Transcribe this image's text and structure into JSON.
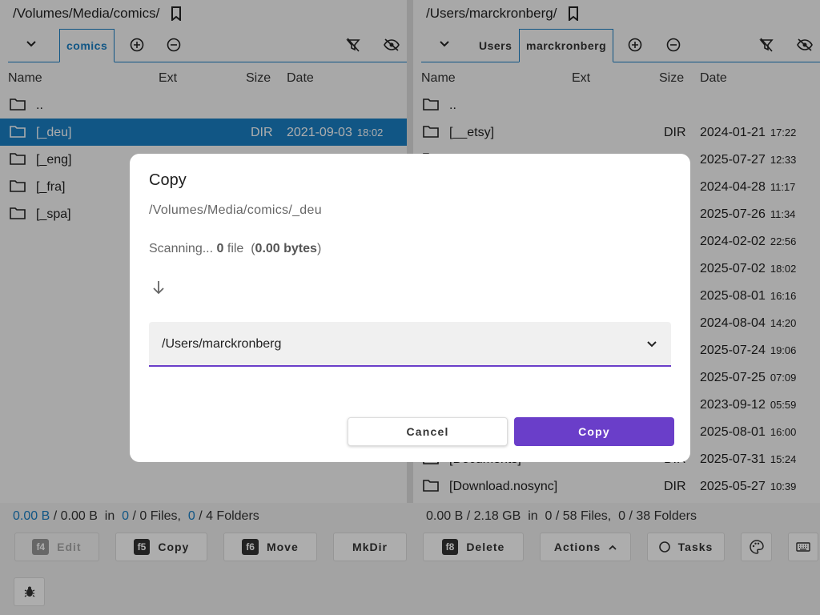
{
  "left": {
    "path": "/Volumes/Media/comics/",
    "tabs": [
      {
        "label": "comics",
        "active": true
      }
    ],
    "columns": {
      "name": "Name",
      "ext": "Ext",
      "size": "Size",
      "date": "Date"
    },
    "rows": [
      {
        "name": "..",
        "size": "",
        "date": "",
        "time": ""
      },
      {
        "name": "[_deu]",
        "size": "DIR",
        "date": "2021-09-03",
        "time": "18:02",
        "selected": true
      },
      {
        "name": "[_eng]",
        "size": "",
        "date": "",
        "time": ""
      },
      {
        "name": "[_fra]",
        "size": "",
        "date": "",
        "time": ""
      },
      {
        "name": "[_spa]",
        "size": "",
        "date": "",
        "time": ""
      }
    ],
    "status": {
      "sel_size": "0.00 B",
      "total_size": "/ 0.00 B",
      "in": "in",
      "sel_files": "0",
      "files": "/ 0 Files,",
      "sel_folders": "0",
      "folders": "/ 4 Folders"
    }
  },
  "right": {
    "path": "/Users/marckronberg/",
    "tabs": [
      {
        "label": "Users",
        "active": false
      },
      {
        "label": "marckronberg",
        "active": true
      }
    ],
    "columns": {
      "name": "Name",
      "ext": "Ext",
      "size": "Size",
      "date": "Date"
    },
    "rows": [
      {
        "name": "..",
        "size": "",
        "date": "",
        "time": ""
      },
      {
        "name": "[__etsy]",
        "size": "DIR",
        "date": "2024-01-21",
        "time": "17:22"
      },
      {
        "name": "",
        "size": "",
        "date": "2025-07-27",
        "time": "12:33"
      },
      {
        "name": "",
        "size": "",
        "date": "2024-04-28",
        "time": "11:17"
      },
      {
        "name": "",
        "size": "",
        "date": "2025-07-26",
        "time": "11:34"
      },
      {
        "name": "",
        "size": "",
        "date": "2024-02-02",
        "time": "22:56"
      },
      {
        "name": "",
        "size": "",
        "date": "2025-07-02",
        "time": "18:02"
      },
      {
        "name": "",
        "size": "",
        "date": "2025-08-01",
        "time": "16:16"
      },
      {
        "name": "",
        "size": "",
        "date": "2024-08-04",
        "time": "14:20"
      },
      {
        "name": "",
        "size": "",
        "date": "2025-07-24",
        "time": "19:06"
      },
      {
        "name": "",
        "size": "",
        "date": "2025-07-25",
        "time": "07:09"
      },
      {
        "name": "",
        "size": "",
        "date": "2023-09-12",
        "time": "05:59"
      },
      {
        "name": "",
        "size": "",
        "date": "2025-08-01",
        "time": "16:00"
      },
      {
        "name": "[Documents]",
        "size": "DIR",
        "date": "2025-07-31",
        "time": "15:24"
      },
      {
        "name": "[Download.nosync]",
        "size": "DIR",
        "date": "2025-05-27",
        "time": "10:39"
      }
    ],
    "status": {
      "text": "0.00 B / 2.18 GB  in  0 / 58 Files,  0 / 38 Folders"
    }
  },
  "toolbar": {
    "edit": {
      "key": "f4",
      "label": "Edit"
    },
    "copy": {
      "key": "f5",
      "label": "Copy"
    },
    "move": {
      "key": "f6",
      "label": "Move"
    },
    "mkdir": {
      "label": "MkDir"
    },
    "delete": {
      "key": "f8",
      "label": "Delete"
    },
    "actions": {
      "label": "Actions"
    },
    "tasks": {
      "label": "Tasks"
    }
  },
  "dialog": {
    "title": "Copy",
    "source": "/Volumes/Media/comics/_deu",
    "scan_prefix": "Scanning...",
    "scan_count": "0",
    "scan_unit": "file",
    "scan_bytes": "0.00 bytes",
    "destination": "/Users/marckronberg",
    "cancel_label": "Cancel",
    "copy_label": "Copy",
    "accent": "#6a3ec9"
  },
  "colors": {
    "selection": "#1a7fc4",
    "accent": "#6a3ec9"
  }
}
